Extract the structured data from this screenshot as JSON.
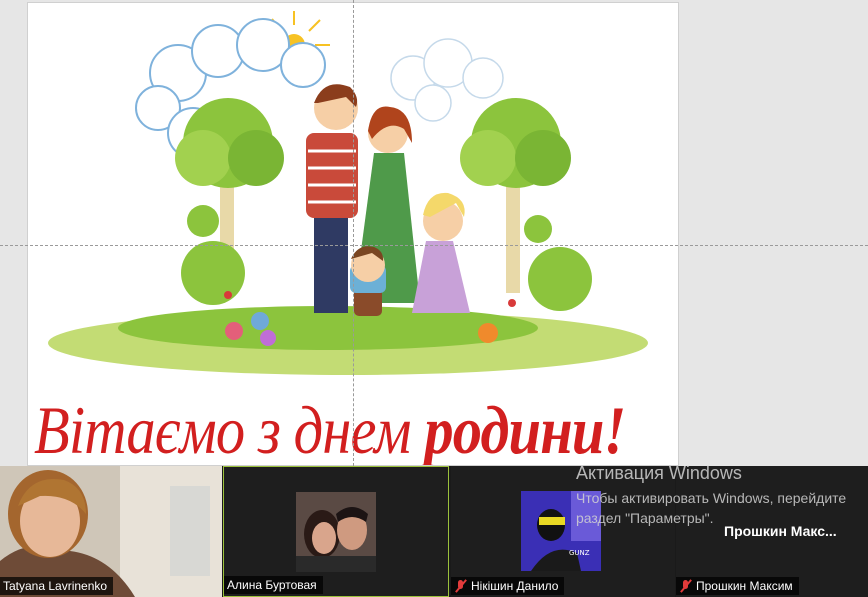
{
  "slide": {
    "greeting_normal": "Вітаємо з днем ",
    "greeting_bold": "родини!"
  },
  "participants": [
    {
      "name": "Tatyana Lavrinenko",
      "muted": false,
      "video": true
    },
    {
      "name": "Алина Буртовая",
      "muted": false,
      "video": false,
      "active_speaker": true
    },
    {
      "name": "Нікішин Данило",
      "muted": true,
      "video": false
    },
    {
      "name": "Прошкин Максим",
      "muted": true,
      "video": false,
      "display_name_large": "Прошкин Макс..."
    }
  ],
  "os_watermark": {
    "title": "Активация Windows",
    "line1": "Чтобы активировать Windows, перейдите",
    "line2": "раздел \"Параметры\"."
  },
  "colors": {
    "greeting": "#d21f1f",
    "active_border": "#9bc13c",
    "muted_icon": "#e23b3b"
  }
}
